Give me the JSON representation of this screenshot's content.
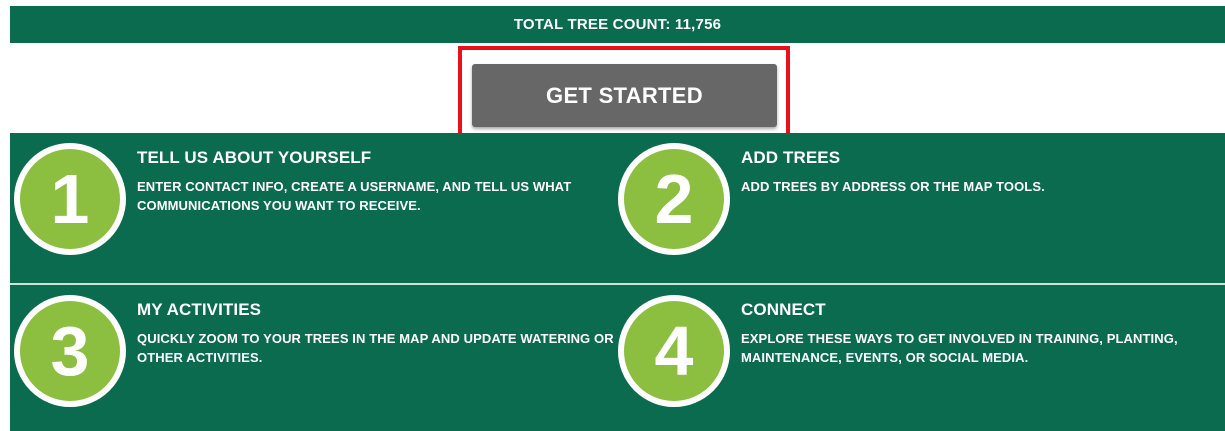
{
  "banner": {
    "text": "TOTAL TREE COUNT: 11,756"
  },
  "cta": {
    "label": "GET STARTED"
  },
  "steps": [
    {
      "number": "1",
      "title": "TELL US ABOUT YOURSELF",
      "description": "ENTER CONTACT INFO, CREATE A USERNAME, AND TELL US WHAT COMMUNICATIONS YOU WANT TO RECEIVE."
    },
    {
      "number": "2",
      "title": "ADD TREES",
      "description": "ADD TREES BY ADDRESS OR THE MAP TOOLS."
    },
    {
      "number": "3",
      "title": "MY ACTIVITIES",
      "description": "QUICKLY ZOOM TO YOUR TREES IN THE MAP AND UPDATE WATERING OR OTHER ACTIVITIES."
    },
    {
      "number": "4",
      "title": "CONNECT",
      "description": "EXPLORE THESE WAYS TO GET INVOLVED IN TRAINING, PLANTING, MAINTENANCE, EVENTS, OR SOCIAL MEDIA."
    }
  ],
  "colors": {
    "brand_green": "#0b6b4f",
    "accent_green": "#8cbf3f",
    "button_gray": "#676767",
    "highlight_red": "#e8101a"
  }
}
